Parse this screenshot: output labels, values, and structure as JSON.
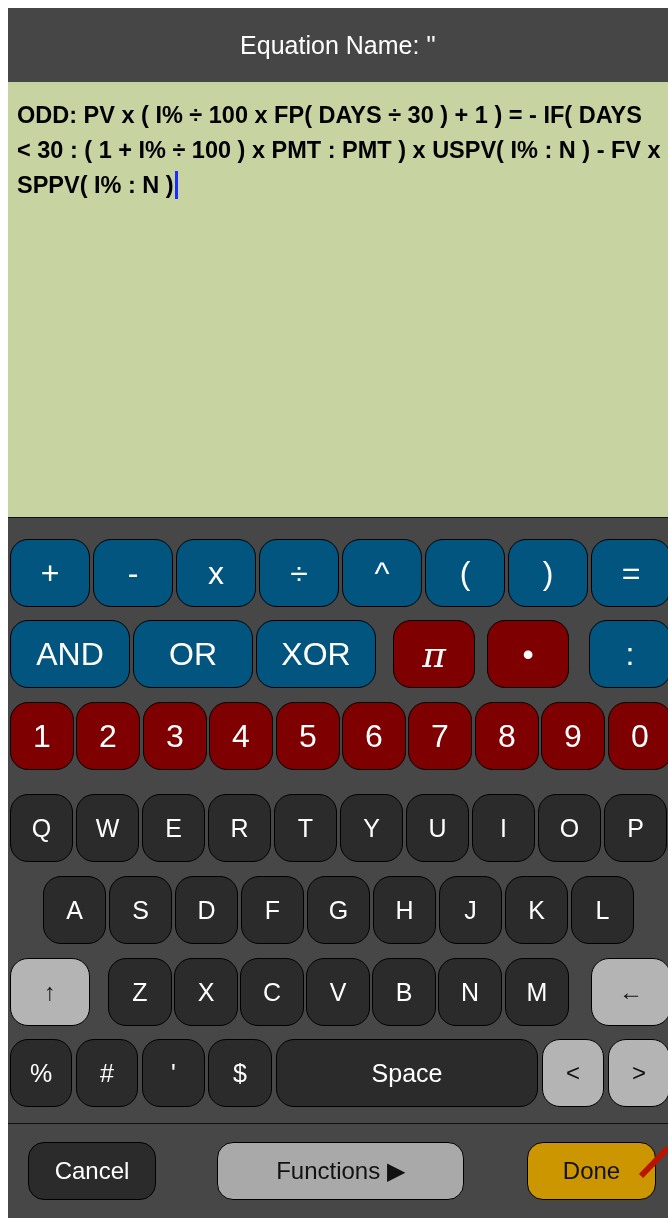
{
  "header": {
    "title": "Equation Name: ''"
  },
  "editor": {
    "text": "ODD: PV x ( I% ÷ 100 x FP( DAYS ÷ 30 ) + 1 ) = - IF( DAYS < 30 : ( 1 + I% ÷ 100 ) x PMT : PMT ) x USPV( I% : N ) - FV x SPPV( I% : N )",
    "caret": true
  },
  "keyboard": [
    [
      {
        "label": "+",
        "kind": "op"
      },
      {
        "label": "-",
        "kind": "op"
      },
      {
        "label": "x",
        "kind": "op"
      },
      {
        "label": "÷",
        "kind": "op"
      },
      {
        "label": "^",
        "kind": "op"
      },
      {
        "label": "(",
        "kind": "op"
      },
      {
        "label": ")",
        "kind": "op"
      },
      {
        "label": "=",
        "kind": "op"
      }
    ],
    [
      {
        "label": "AND",
        "kind": "op"
      },
      {
        "label": "OR",
        "kind": "op"
      },
      {
        "label": "XOR",
        "kind": "op"
      },
      {
        "label": "π",
        "kind": "pi"
      },
      {
        "label": "•",
        "kind": "num"
      },
      {
        "label": ":",
        "kind": "op"
      }
    ],
    [
      {
        "label": "1",
        "kind": "num"
      },
      {
        "label": "2",
        "kind": "num"
      },
      {
        "label": "3",
        "kind": "num"
      },
      {
        "label": "4",
        "kind": "num"
      },
      {
        "label": "5",
        "kind": "num"
      },
      {
        "label": "6",
        "kind": "num"
      },
      {
        "label": "7",
        "kind": "num"
      },
      {
        "label": "8",
        "kind": "num"
      },
      {
        "label": "9",
        "kind": "num"
      },
      {
        "label": "0",
        "kind": "num"
      }
    ],
    [
      {
        "label": "Q",
        "kind": "letter"
      },
      {
        "label": "W",
        "kind": "letter"
      },
      {
        "label": "E",
        "kind": "letter"
      },
      {
        "label": "R",
        "kind": "letter"
      },
      {
        "label": "T",
        "kind": "letter"
      },
      {
        "label": "Y",
        "kind": "letter"
      },
      {
        "label": "U",
        "kind": "letter"
      },
      {
        "label": "I",
        "kind": "letter"
      },
      {
        "label": "O",
        "kind": "letter"
      },
      {
        "label": "P",
        "kind": "letter"
      }
    ],
    [
      {
        "label": "A",
        "kind": "letter"
      },
      {
        "label": "S",
        "kind": "letter"
      },
      {
        "label": "D",
        "kind": "letter"
      },
      {
        "label": "F",
        "kind": "letter"
      },
      {
        "label": "G",
        "kind": "letter"
      },
      {
        "label": "H",
        "kind": "letter"
      },
      {
        "label": "J",
        "kind": "letter"
      },
      {
        "label": "K",
        "kind": "letter"
      },
      {
        "label": "L",
        "kind": "letter"
      }
    ],
    [
      {
        "label": "↑",
        "kind": "mod"
      },
      {
        "label": "Z",
        "kind": "letter"
      },
      {
        "label": "X",
        "kind": "letter"
      },
      {
        "label": "C",
        "kind": "letter"
      },
      {
        "label": "V",
        "kind": "letter"
      },
      {
        "label": "B",
        "kind": "letter"
      },
      {
        "label": "N",
        "kind": "letter"
      },
      {
        "label": "M",
        "kind": "letter"
      },
      {
        "label": "←",
        "kind": "mod"
      }
    ],
    [
      {
        "label": "%",
        "kind": "letter"
      },
      {
        "label": "#",
        "kind": "letter"
      },
      {
        "label": "'",
        "kind": "letter"
      },
      {
        "label": "$",
        "kind": "letter"
      },
      {
        "label": "Space",
        "kind": "letter"
      },
      {
        "label": "<",
        "kind": "mod"
      },
      {
        "label": ">",
        "kind": "mod"
      }
    ]
  ],
  "footer": [
    {
      "label": "Cancel",
      "kind": "cancel"
    },
    {
      "label": "Functions ▶",
      "kind": "functions"
    },
    {
      "label": "Done",
      "kind": "done"
    }
  ]
}
